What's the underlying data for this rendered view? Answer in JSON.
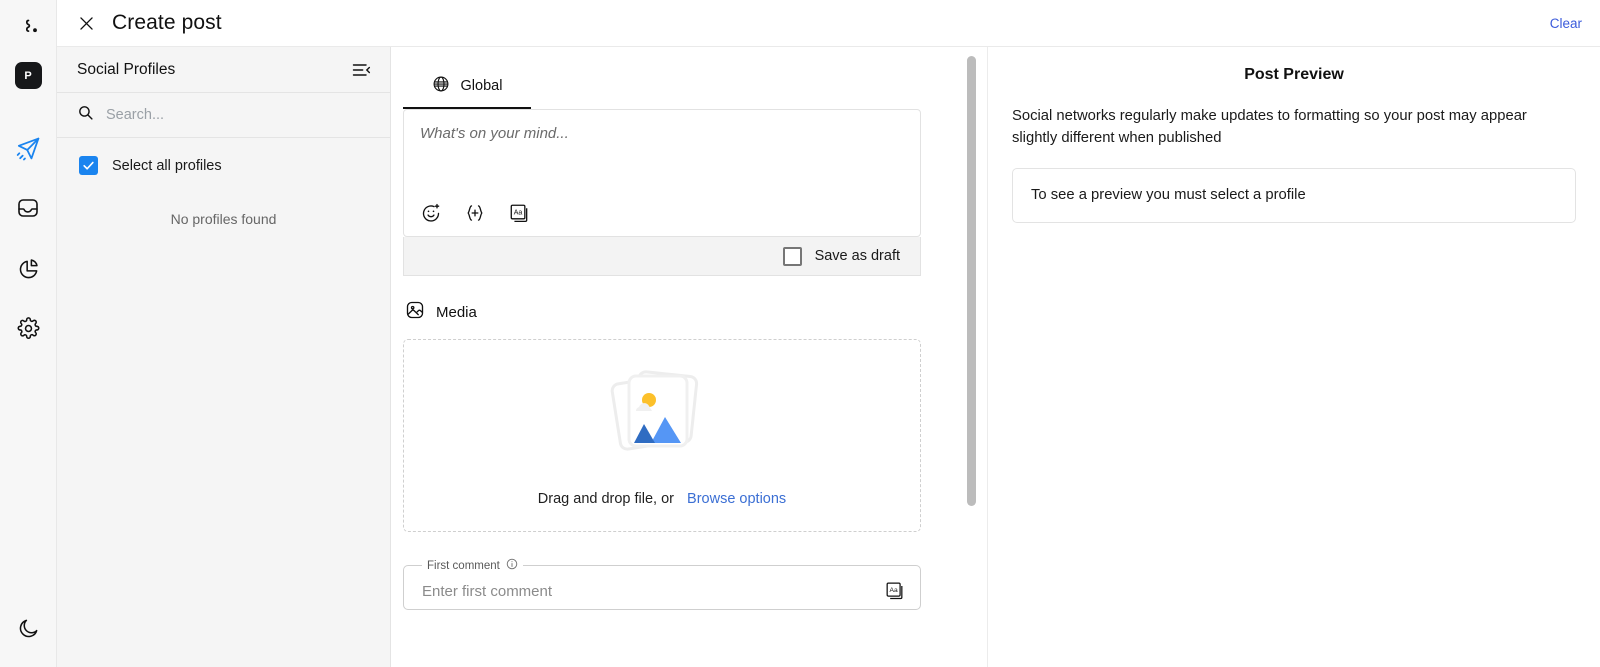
{
  "rail": {
    "logo_icon": "brand-logo-icon",
    "badge_label": "P",
    "items": [
      {
        "icon": "send-plane-icon",
        "name": "publish",
        "active": true
      },
      {
        "icon": "inbox-icon",
        "name": "inbox",
        "active": false
      },
      {
        "icon": "pie-chart-icon",
        "name": "analytics",
        "active": false
      },
      {
        "icon": "gear-icon",
        "name": "settings",
        "active": false
      }
    ],
    "theme_toggle_icon": "moon-icon"
  },
  "topbar": {
    "close_icon": "close-icon",
    "title": "Create post",
    "clear_label": "Clear"
  },
  "profiles": {
    "heading": "Social Profiles",
    "collapse_icon": "collapse-sidebar-icon",
    "search_placeholder": "Search...",
    "search_value": "",
    "search_icon": "search-icon",
    "select_all_label": "Select all profiles",
    "select_all_checked": true,
    "empty_text": "No profiles found"
  },
  "editor": {
    "tabs": [
      {
        "label": "Global",
        "icon": "globe-icon",
        "active": true
      }
    ],
    "compose_placeholder": "What's on your mind...",
    "compose_value": "",
    "tools": [
      {
        "name": "emoji-icon",
        "label": "emoji"
      },
      {
        "name": "variable-icon",
        "label": "{+}"
      },
      {
        "name": "text-template-icon",
        "label": "Aa"
      }
    ],
    "save_draft_label": "Save as draft",
    "save_draft_checked": false,
    "media": {
      "icon": "image-icon",
      "title": "Media",
      "drop_text": "Drag and drop file, or",
      "browse_label": "Browse options"
    },
    "first_comment": {
      "legend": "First comment",
      "info_icon": "info-icon",
      "placeholder": "Enter first comment",
      "value": "",
      "trailing_icon": "text-template-icon"
    }
  },
  "preview": {
    "title": "Post Preview",
    "note": "Social networks regularly make updates to formatting so your post may appear slightly different when published",
    "empty_message": "To see a preview you must select a profile"
  },
  "colors": {
    "accent_blue": "#1a84ef",
    "link_blue": "#3b5bdb",
    "browse_blue": "#3b6fd4",
    "panel_grey": "#f5f5f5",
    "draft_bar_grey": "#f3f3f3"
  }
}
